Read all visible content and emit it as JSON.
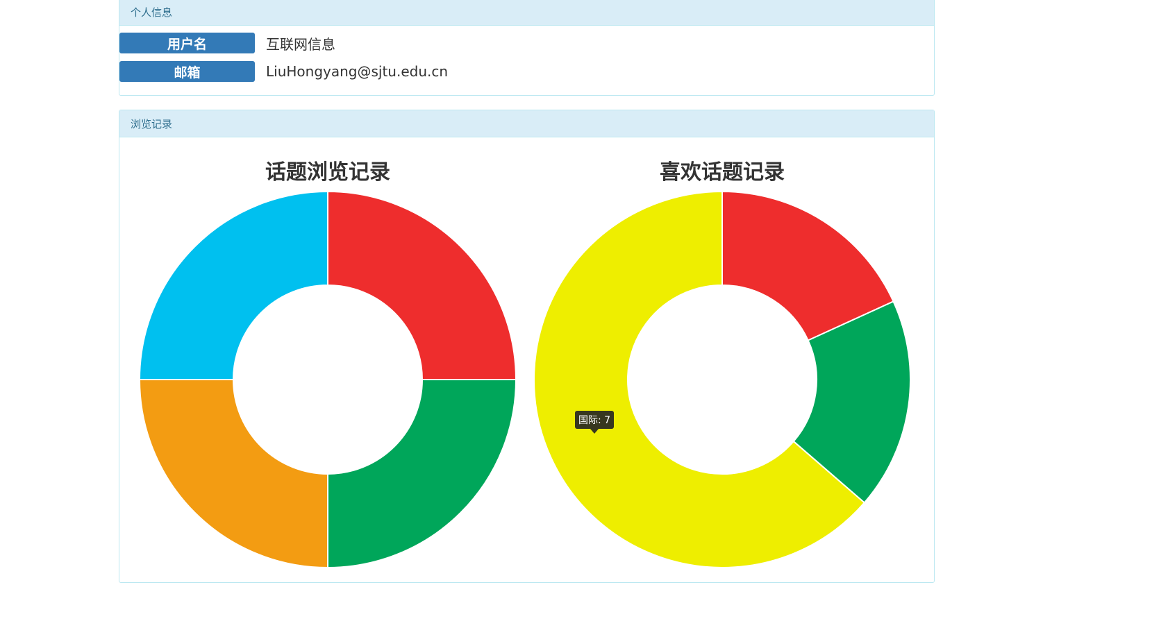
{
  "personal_info": {
    "heading": "个人信息",
    "username_label": "用户名",
    "username_value": "互联网信息",
    "email_label": "邮箱",
    "email_value": "LiuHongyang@sjtu.edu.cn"
  },
  "history": {
    "heading": "浏览记录"
  },
  "chart_data": [
    {
      "type": "pie",
      "variant": "doughnut",
      "title": "话题浏览记录",
      "slices": [
        {
          "value": 1,
          "color": "#ee2d2d"
        },
        {
          "value": 1,
          "color": "#00a65a"
        },
        {
          "value": 1,
          "color": "#f39c12"
        },
        {
          "value": 1,
          "color": "#00c0ef"
        }
      ]
    },
    {
      "type": "pie",
      "variant": "doughnut",
      "title": "喜欢话题记录",
      "slices": [
        {
          "value": 2,
          "color": "#ee2d2d"
        },
        {
          "value": 2,
          "color": "#00a65a"
        },
        {
          "value": 7,
          "color": "#eeee00",
          "label": "国际"
        }
      ],
      "tooltip": {
        "label": "国际",
        "value": 7,
        "text": "国际: 7"
      }
    }
  ]
}
